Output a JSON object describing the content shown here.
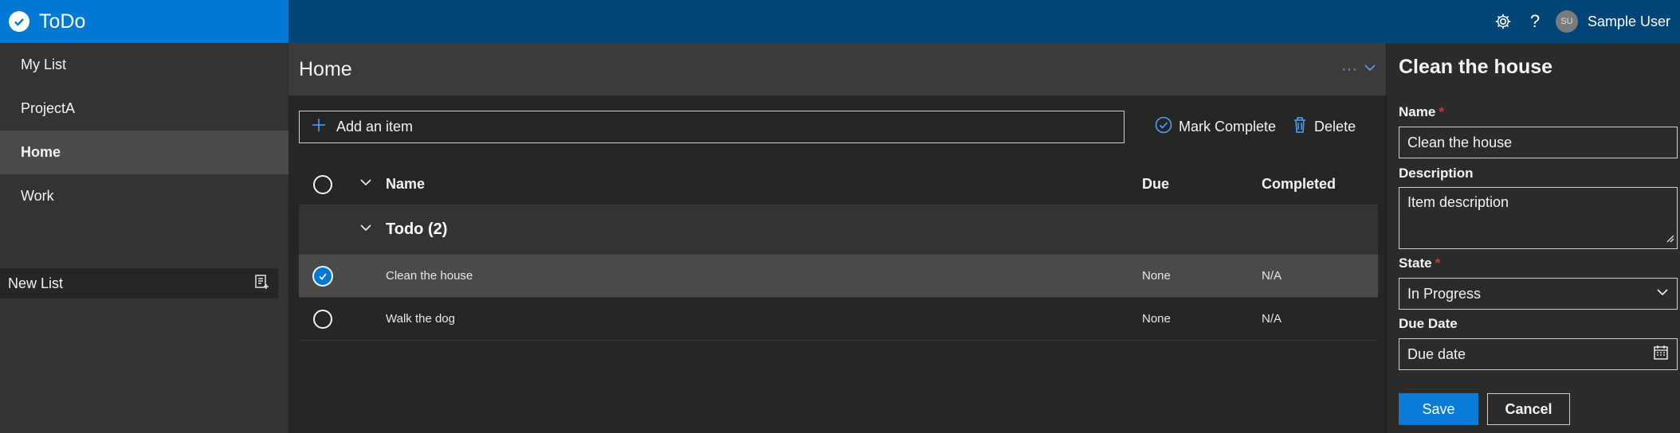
{
  "app": {
    "title": "ToDo"
  },
  "topbar": {
    "help_glyph": "?",
    "avatar_initials": "SU",
    "user_name": "Sample User"
  },
  "sidebar": {
    "items": [
      {
        "label": "My List"
      },
      {
        "label": "ProjectA"
      },
      {
        "label": "Home"
      },
      {
        "label": "Work"
      }
    ],
    "new_list_placeholder": "New List"
  },
  "main": {
    "title": "Home",
    "more_glyph": "···",
    "add_item_placeholder": "Add an item",
    "mark_complete_label": "Mark Complete",
    "delete_label": "Delete",
    "columns": {
      "name": "Name",
      "due": "Due",
      "completed": "Completed"
    },
    "group_label": "Todo (2)",
    "rows": [
      {
        "name": "Clean the house",
        "due": "None",
        "completed": "N/A",
        "selected": true
      },
      {
        "name": "Walk the dog",
        "due": "None",
        "completed": "N/A",
        "selected": false
      }
    ]
  },
  "panel": {
    "title": "Clean the house",
    "name_label": "Name",
    "name_value": "Clean the house",
    "required_mark": "*",
    "description_label": "Description",
    "description_placeholder": "Item description",
    "state_label": "State",
    "state_value": "In Progress",
    "due_label": "Due Date",
    "due_placeholder": "Due date",
    "save_label": "Save",
    "cancel_label": "Cancel"
  },
  "colors": {
    "brand": "#0078d4",
    "topbar": "#004578",
    "accent_link": "#4da3ff",
    "required": "#d13438"
  }
}
